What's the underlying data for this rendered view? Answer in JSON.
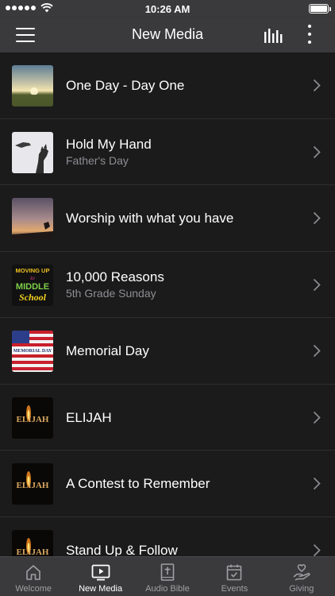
{
  "status_bar": {
    "time": "10:26 AM"
  },
  "nav": {
    "title": "New Media"
  },
  "media": [
    {
      "title": "One Day - Day One",
      "subtitle": "",
      "thumb": "sunset-field"
    },
    {
      "title": "Hold My Hand",
      "subtitle": "Father's Day",
      "thumb": "hands"
    },
    {
      "title": "Worship with what you have",
      "subtitle": "",
      "thumb": "cloudy-sky"
    },
    {
      "title": "10,000 Reasons",
      "subtitle": "5th Grade Sunday",
      "thumb": "moving-up-middle-school",
      "thumb_text": [
        "MOVING UP",
        "to",
        "MIDDLE",
        "School"
      ]
    },
    {
      "title": "Memorial Day",
      "subtitle": "",
      "thumb": "american-flag",
      "thumb_text": [
        "MEMORIAL DAY"
      ]
    },
    {
      "title": "ELIJAH",
      "subtitle": "",
      "thumb": "elijah-flame",
      "thumb_text": [
        "ELIJAH"
      ]
    },
    {
      "title": "A Contest to Remember",
      "subtitle": "",
      "thumb": "elijah-flame",
      "thumb_text": [
        "ELIJAH"
      ]
    },
    {
      "title": "Stand Up & Follow",
      "subtitle": "",
      "thumb": "elijah-flame",
      "thumb_text": [
        "ELIJAH"
      ]
    }
  ],
  "tabs": [
    {
      "label": "Welcome",
      "icon": "home-icon",
      "active": false
    },
    {
      "label": "New Media",
      "icon": "tv-play-icon",
      "active": true
    },
    {
      "label": "Audio Bible",
      "icon": "bible-icon",
      "active": false
    },
    {
      "label": "Events",
      "icon": "calendar-check-icon",
      "active": false
    },
    {
      "label": "Giving",
      "icon": "hand-heart-icon",
      "active": false
    }
  ],
  "colors": {
    "bar_background": "#3a3a3c",
    "list_background": "#1b1b1c",
    "separator": "#2e2e30",
    "subtitle": "#8e8e93",
    "tab_inactive": "#a0a0a4"
  }
}
